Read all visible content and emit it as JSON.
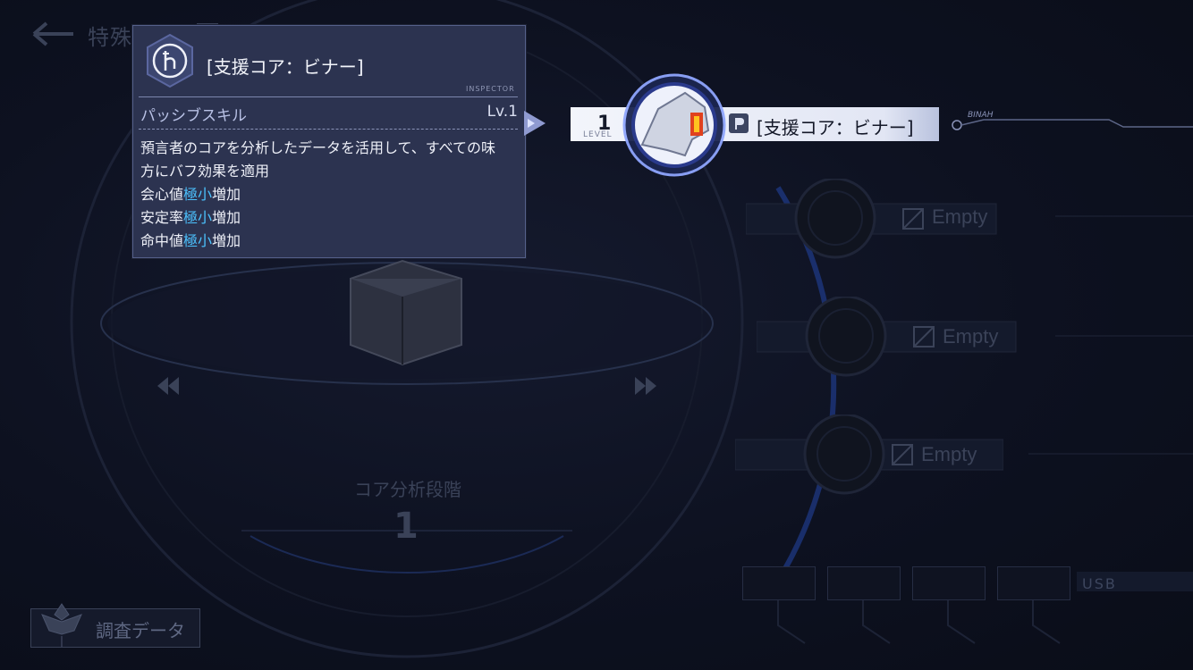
{
  "header": {
    "title": "特殊作業"
  },
  "inspector": {
    "title": "[支援コア：ビナー]",
    "tag": "INSPECTOR",
    "skill_type": "パッシブスキル",
    "level": "Lv.1",
    "desc_line1": "預言者のコアを分析したデータを活用して、すべての味",
    "desc_line2": "方にバフ効果を適用",
    "effects": [
      {
        "prefix": "会心値",
        "highlight": "極小",
        "suffix": "増加"
      },
      {
        "prefix": "安定率",
        "highlight": "極小",
        "suffix": "増加"
      },
      {
        "prefix": "命中値",
        "highlight": "極小",
        "suffix": "増加"
      }
    ]
  },
  "equipped_core": {
    "level_num": "1",
    "level_label": "LEVEL",
    "name": "[支援コア：ビナー]",
    "tag": "BINAH"
  },
  "slots": [
    {
      "label": "Empty"
    },
    {
      "label": "Empty"
    },
    {
      "label": "Empty"
    }
  ],
  "analysis": {
    "title": "コア分析段階",
    "stage": "1"
  },
  "footer": {
    "research_label": "調査データ",
    "usb_label": "USB"
  },
  "colors": {
    "accent": "#4cc3ff",
    "panel": "#2c3350",
    "background": "#0d1120"
  }
}
